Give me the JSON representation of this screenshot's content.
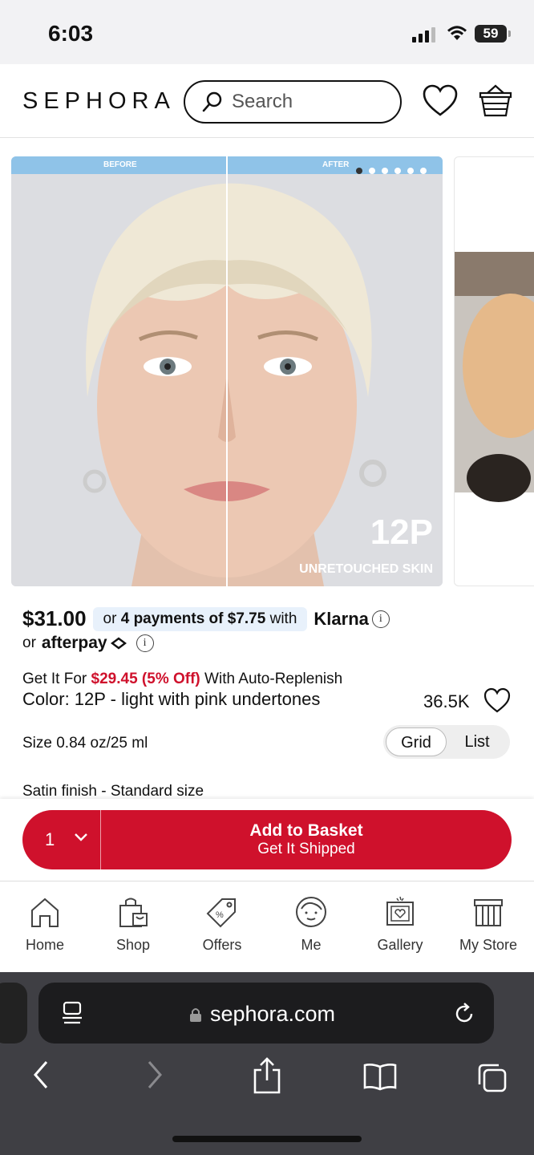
{
  "status": {
    "time": "6:03",
    "battery": "59"
  },
  "header": {
    "logo": "SEPHORA",
    "search_placeholder": "Search"
  },
  "carousel": {
    "before_label": "BEFORE",
    "after_label": "AFTER",
    "shade_label": "12P",
    "caption": "UNRETOUCHED SKIN",
    "slide_count": 6,
    "active_slide": 1
  },
  "product": {
    "price": "$31.00",
    "klarna_text": "or 4 payments of $7.75 with",
    "klarna_text_prefix": "or ",
    "klarna_text_bold": "4 payments of $7.75",
    "klarna_text_suffix": " with",
    "klarna_logo": "Klarna",
    "afterpay_prefix": "or",
    "afterpay_logo": "afterpay",
    "replenish_prefix": "Get It For ",
    "replenish_price": "$29.45 (5% Off)",
    "replenish_suffix": " With Auto-Replenish",
    "color": "Color: 12P - light with pink undertones",
    "likes": "36.5K",
    "size": "Size 0.84 oz/25 ml",
    "view_toggle": {
      "options": [
        "Grid",
        "List"
      ],
      "selected": "Grid"
    },
    "finish": "Satin finish - Standard size"
  },
  "cta": {
    "quantity": "1",
    "label": "Add to Basket",
    "sublabel": "Get It Shipped",
    "color": "#cf112c"
  },
  "tabbar": {
    "items": [
      {
        "label": "Home",
        "icon": "home-icon"
      },
      {
        "label": "Shop",
        "icon": "shopping-bag-icon"
      },
      {
        "label": "Offers",
        "icon": "tag-icon"
      },
      {
        "label": "Me",
        "icon": "face-icon"
      },
      {
        "label": "Gallery",
        "icon": "gallery-icon"
      },
      {
        "label": "My Store",
        "icon": "store-icon"
      }
    ]
  },
  "browser": {
    "url": "sephora.com"
  }
}
